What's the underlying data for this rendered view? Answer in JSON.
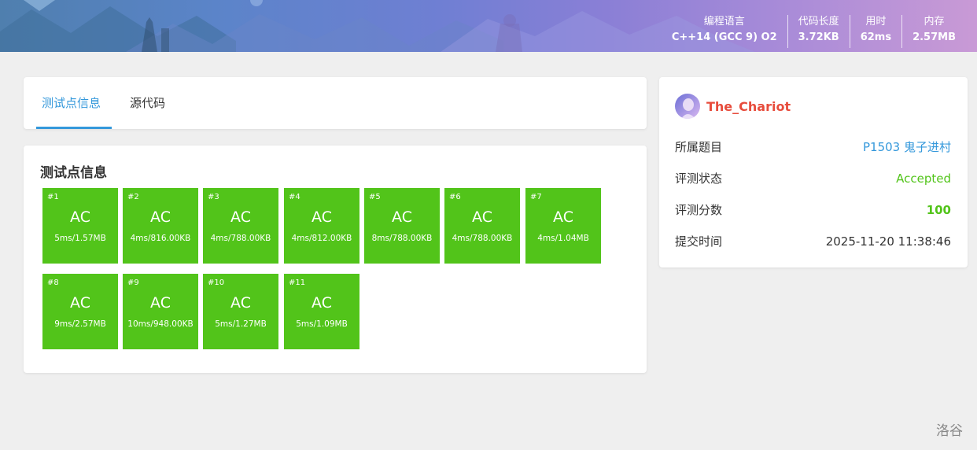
{
  "header": {
    "stats": [
      {
        "label": "编程语言",
        "value": "C++14 (GCC 9) O2"
      },
      {
        "label": "代码长度",
        "value": "3.72KB"
      },
      {
        "label": "用时",
        "value": "62ms"
      },
      {
        "label": "内存",
        "value": "2.57MB"
      }
    ]
  },
  "tabs": [
    {
      "label": "测试点信息",
      "active": true
    },
    {
      "label": "源代码",
      "active": false
    }
  ],
  "tests": {
    "title": "测试点信息",
    "color": "#52c41a",
    "cases": [
      {
        "idx": "#1",
        "status": "AC",
        "result": "5ms/1.57MB"
      },
      {
        "idx": "#2",
        "status": "AC",
        "result": "4ms/816.00KB"
      },
      {
        "idx": "#3",
        "status": "AC",
        "result": "4ms/788.00KB"
      },
      {
        "idx": "#4",
        "status": "AC",
        "result": "4ms/812.00KB"
      },
      {
        "idx": "#5",
        "status": "AC",
        "result": "8ms/788.00KB"
      },
      {
        "idx": "#6",
        "status": "AC",
        "result": "4ms/788.00KB"
      },
      {
        "idx": "#7",
        "status": "AC",
        "result": "4ms/1.04MB"
      },
      {
        "idx": "#8",
        "status": "AC",
        "result": "9ms/2.57MB"
      },
      {
        "idx": "#9",
        "status": "AC",
        "result": "10ms/948.00KB"
      },
      {
        "idx": "#10",
        "status": "AC",
        "result": "5ms/1.27MB"
      },
      {
        "idx": "#11",
        "status": "AC",
        "result": "5ms/1.09MB"
      }
    ]
  },
  "info": {
    "username": "The_Chariot",
    "rows": [
      {
        "key": "所属题目",
        "value": "P1503 鬼子进村"
      },
      {
        "key": "评测状态",
        "value": "Accepted"
      },
      {
        "key": "评测分数",
        "value": "100"
      },
      {
        "key": "提交时间",
        "value": "2025-11-20 11:38:46"
      }
    ]
  },
  "brand": "洛谷",
  "colors": {
    "accent": "#3498db",
    "accepted": "#52c41a",
    "username": "#e74c3c"
  }
}
